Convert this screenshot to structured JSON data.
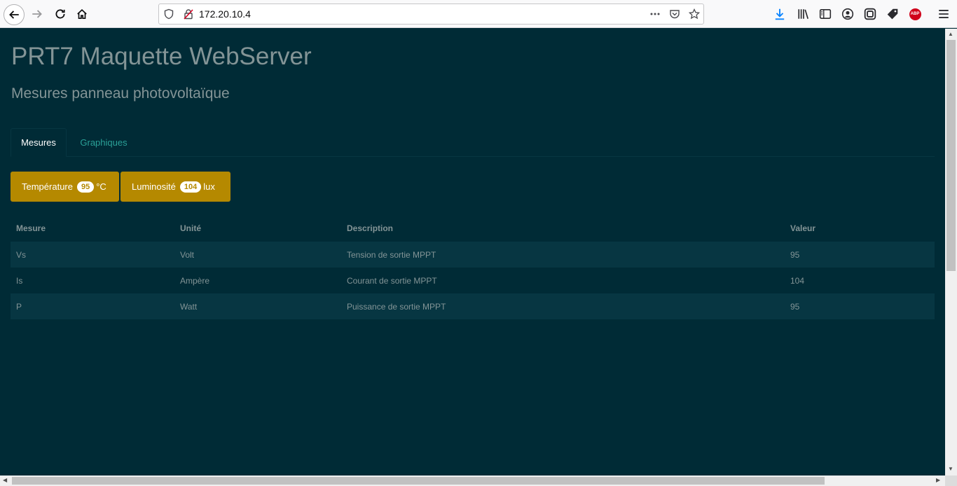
{
  "browser": {
    "url": "172.20.10.4",
    "icons": {
      "back": "back-arrow-icon",
      "forward": "forward-arrow-icon",
      "reload": "reload-icon",
      "home": "home-icon",
      "tracking": "shield-icon",
      "insecure": "broken-lock-icon",
      "more": "more-icon",
      "pocket": "pocket-icon",
      "bookmark": "star-icon",
      "download": "download-icon",
      "library": "library-icon",
      "sidebar": "sidebar-icon",
      "account": "account-icon",
      "container": "container-icon",
      "tag": "tag-icon",
      "adblock": "abp-icon",
      "menu": "hamburger-menu-icon"
    },
    "abp_label": "ABP"
  },
  "page": {
    "title": "PRT7 Maquette WebServer",
    "subtitle": "Mesures panneau photovoltaïque"
  },
  "tabs": [
    {
      "label": "Mesures",
      "active": true
    },
    {
      "label": "Graphiques",
      "active": false
    }
  ],
  "badges": {
    "temperature": {
      "label": "Température",
      "value": "95",
      "unit": "°C"
    },
    "luminosity": {
      "label": "Luminosité",
      "value": "104",
      "unit": "lux"
    }
  },
  "table": {
    "headers": [
      "Mesure",
      "Unité",
      "Description",
      "Valeur"
    ],
    "rows": [
      [
        "Vs",
        "Volt",
        "Tension de sortie MPPT",
        "95"
      ],
      [
        "Is",
        "Ampère",
        "Courant de sortie MPPT",
        "104"
      ],
      [
        "P",
        "Watt",
        "Puissance de sortie MPPT",
        "95"
      ]
    ]
  },
  "colors": {
    "background": "#002b36",
    "row_stripe": "#073642",
    "text": "#839496",
    "tab_link": "#2aa198",
    "badge": "#b58900"
  }
}
